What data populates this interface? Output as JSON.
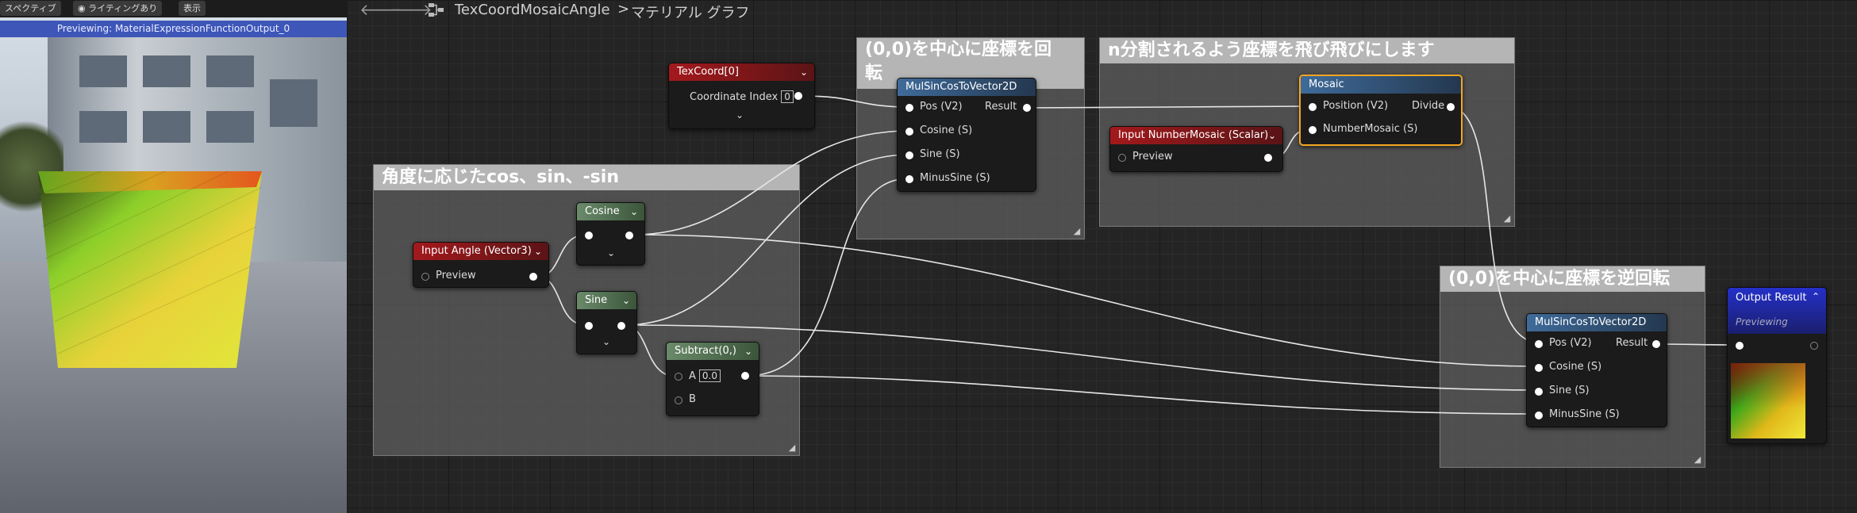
{
  "viewport": {
    "toolbar": {
      "perspective": "スペクティブ",
      "lighting": "ライティングあり",
      "show": "表示"
    },
    "banner": "Previewing: MaterialExpressionFunctionOutput_0"
  },
  "breadcrumb": {
    "title": "TexCoordMosaicAngle",
    "separator": ">",
    "graph": "マテリアル グラフ"
  },
  "comments": {
    "rotate": "(0,0)を中心に座標を回",
    "rotate_line2": "転",
    "mosaic": "n分割されるよう座標を飛び飛びにします",
    "angle": "角度に応じたcos、sin、-sin",
    "inverse": "(0,0)を中心に座標を逆回転"
  },
  "nodes": {
    "texcoord": {
      "title": "TexCoord[0]",
      "pin_label": "Coordinate Index",
      "value": "0"
    },
    "mulsin1": {
      "title": "MulSinCosToVector2D",
      "inputs": [
        "Pos (V2)",
        "Cosine (S)",
        "Sine (S)",
        "MinusSine (S)"
      ],
      "output": "Result"
    },
    "mosaic": {
      "title": "Mosaic",
      "inputs": [
        "Position (V2)",
        "NumberMosaic (S)"
      ],
      "output": "Divide"
    },
    "input_num": {
      "title": "Input NumberMosaic (Scalar)",
      "pin_label": "Preview"
    },
    "cosine": {
      "title": "Cosine"
    },
    "input_angle": {
      "title": "Input Angle (Vector3)",
      "pin_label": "Preview"
    },
    "sine": {
      "title": "Sine"
    },
    "subtract": {
      "title": "Subtract(0,)",
      "pin_a": "A",
      "a_value": "0.0",
      "pin_b": "B"
    },
    "mulsin2": {
      "title": "MulSinCosToVector2D",
      "inputs": [
        "Pos (V2)",
        "Cosine (S)",
        "Sine (S)",
        "MinusSine (S)"
      ],
      "output": "Result"
    },
    "output": {
      "title": "Output Result",
      "subtitle": "Previewing"
    }
  },
  "colors": {
    "input_head": "#8c1c1c",
    "math_head": "#4d6b4d",
    "function_head": "#2d4a6e",
    "output_head": "#1f2aa6",
    "mosaic_border": "#f5a623"
  }
}
